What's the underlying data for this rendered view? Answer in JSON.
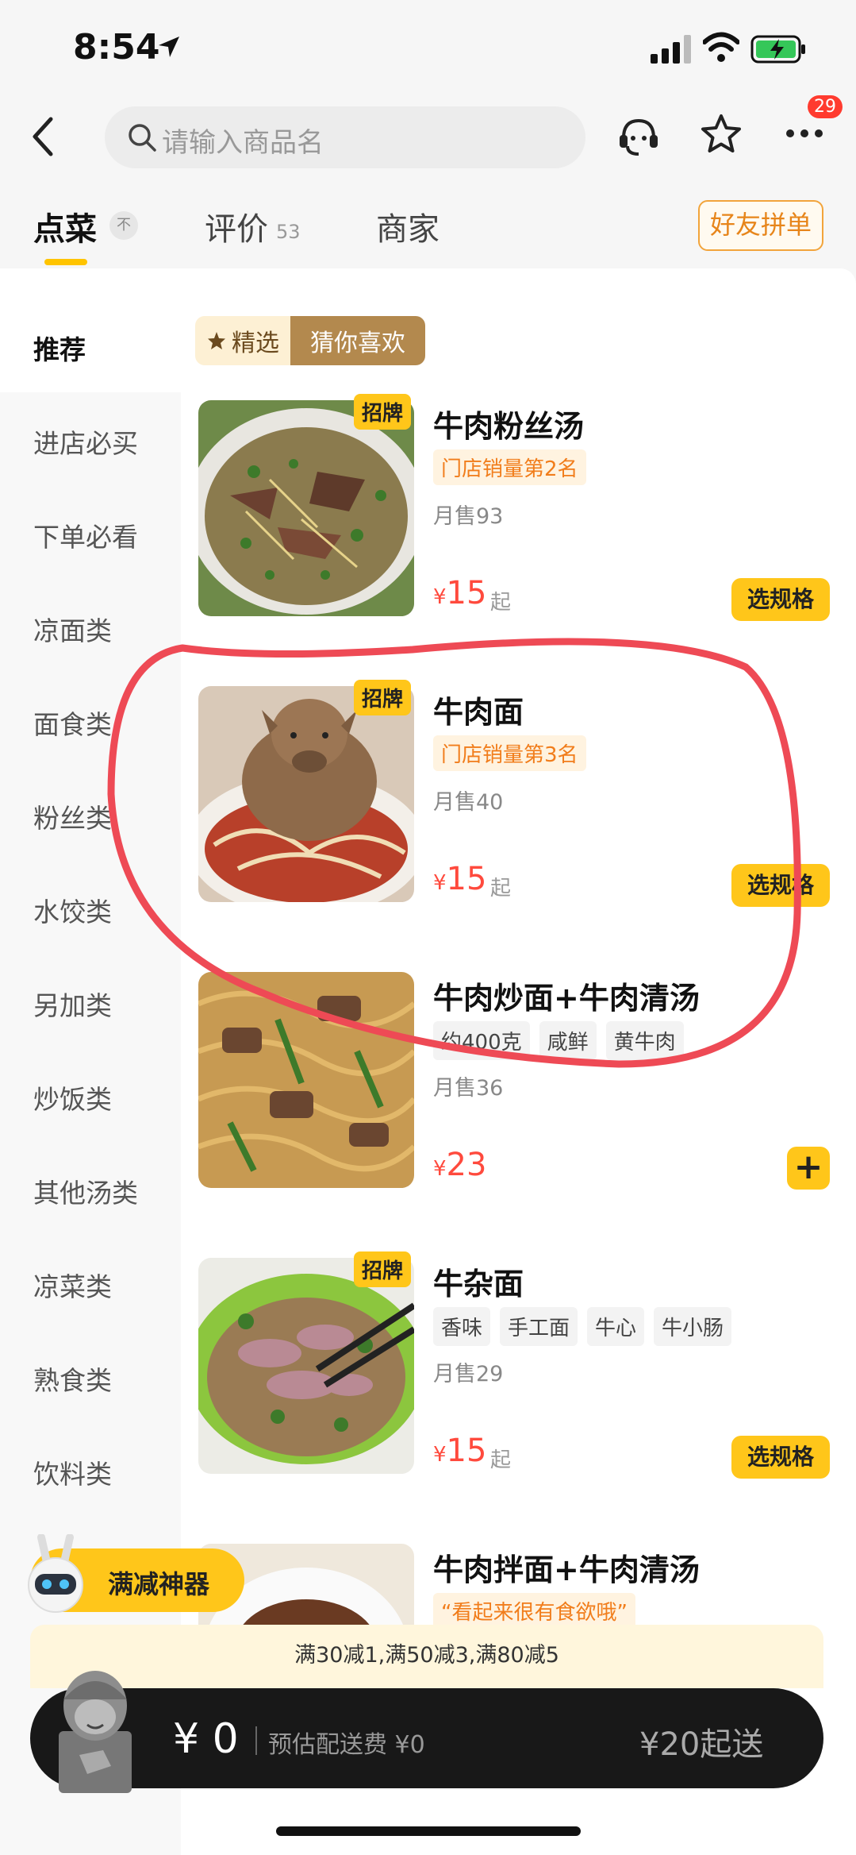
{
  "status_bar": {
    "time": "8:54"
  },
  "nav": {
    "search_placeholder": "请输入商品名",
    "badge_count": "29"
  },
  "tabs": {
    "order": "点菜",
    "sort": "不",
    "review": "评价",
    "review_count": "53",
    "shop": "商家",
    "group_button": "好友拼单"
  },
  "sidebar": [
    "推荐",
    "进店必买",
    "下单必看",
    "凉面类",
    "面食类",
    "粉丝类",
    "水饺类",
    "另加类",
    "炒饭类",
    "其他汤类",
    "凉菜类",
    "熟食类",
    "饮料类"
  ],
  "filter": {
    "featured": "精选",
    "guess": "猜你喜欢"
  },
  "items": [
    {
      "name": "牛肉粉丝汤",
      "signature": "招牌",
      "rank": "门店销量第2名",
      "sales": "月售93",
      "currency": "¥",
      "price": "15",
      "from": "起",
      "action": "选规格"
    },
    {
      "name": "牛肉面",
      "signature": "招牌",
      "rank": "门店销量第3名",
      "sales": "月售40",
      "currency": "¥",
      "price": "15",
      "from": "起",
      "action": "选规格"
    },
    {
      "name": "牛肉炒面+牛肉清汤",
      "tags": [
        "约400克",
        "咸鲜",
        "黄牛肉"
      ],
      "sales": "月售36",
      "currency": "¥",
      "price": "23",
      "action": "+"
    },
    {
      "name": "牛杂面",
      "signature": "招牌",
      "tags": [
        "香味",
        "手工面",
        "牛心",
        "牛小肠"
      ],
      "sales": "月售29",
      "currency": "¥",
      "price": "15",
      "from": "起",
      "action": "选规格"
    },
    {
      "name": "牛肉拌面+牛肉清汤",
      "quote": "“看起来很有食欲哦”"
    }
  ],
  "promo": {
    "label": "满减神器",
    "strip": "满30减1,满50减3,满80减5"
  },
  "cart": {
    "amount": "¥ 0",
    "fee": "预估配送费 ¥0",
    "minimum": "¥20起送"
  },
  "colors": {
    "accent": "#ffc61a",
    "price": "#ff4a3d",
    "annotation": "#ee4a55"
  }
}
